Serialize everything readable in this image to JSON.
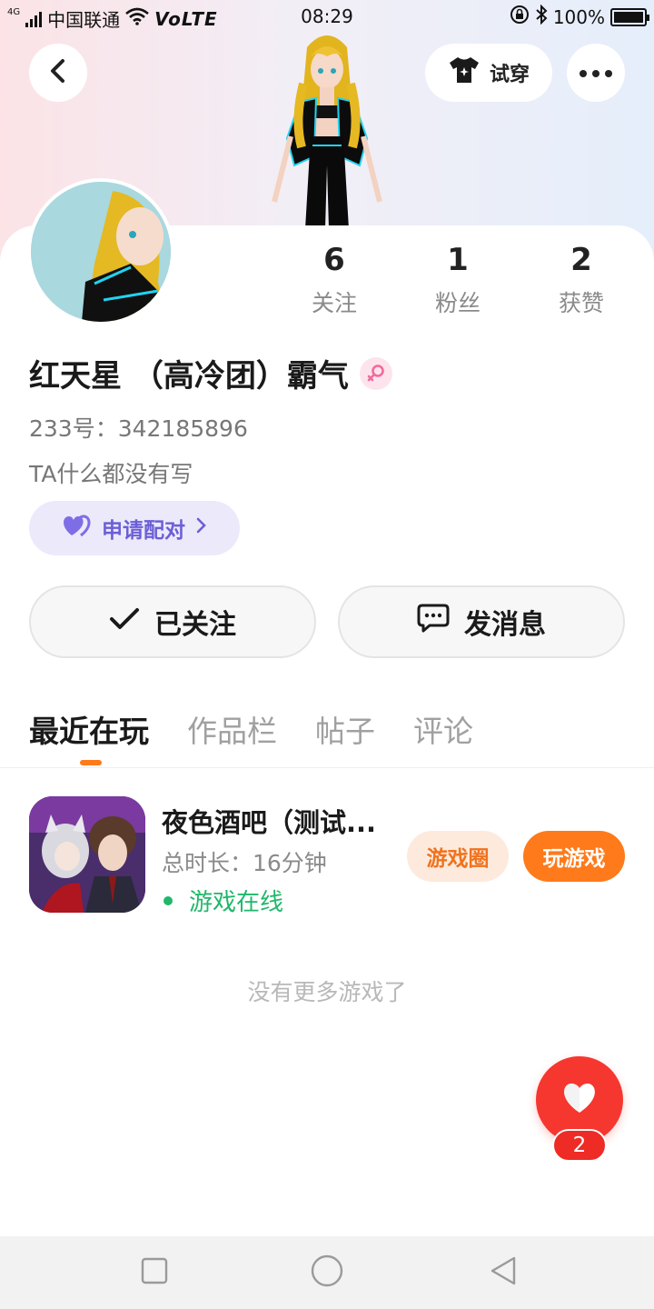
{
  "status_bar": {
    "network": "4G",
    "carrier": "中国联通",
    "volte": "VoLTE",
    "time": "08:29",
    "battery": "100%"
  },
  "header": {
    "try_on_label": "试穿"
  },
  "profile": {
    "stats": [
      {
        "value": "6",
        "label": "关注"
      },
      {
        "value": "1",
        "label": "粉丝"
      },
      {
        "value": "2",
        "label": "获赞"
      }
    ],
    "name": "红天星 （高冷团）霸气",
    "gender_symbol": "♀",
    "uid": "233号：342185896",
    "bio": "TA什么都没有写",
    "pair_label": "申请配对",
    "follow_label": "已关注",
    "message_label": "发消息"
  },
  "tabs": [
    {
      "label": "最近在玩",
      "active": true
    },
    {
      "label": "作品栏",
      "active": false
    },
    {
      "label": "帖子",
      "active": false
    },
    {
      "label": "评论",
      "active": false
    }
  ],
  "games": [
    {
      "title": "夜色酒吧（测试...",
      "duration": "总时长：16分钟",
      "status": "游戏在线",
      "circle_label": "游戏圈",
      "play_label": "玩游戏"
    }
  ],
  "empty_text": "没有更多游戏了",
  "likes": {
    "count": "2"
  },
  "colors": {
    "accent": "#ff7a1a",
    "like_red": "#f5372f",
    "online_green": "#1fb86a",
    "pair_purple": "#6b5fd6"
  }
}
